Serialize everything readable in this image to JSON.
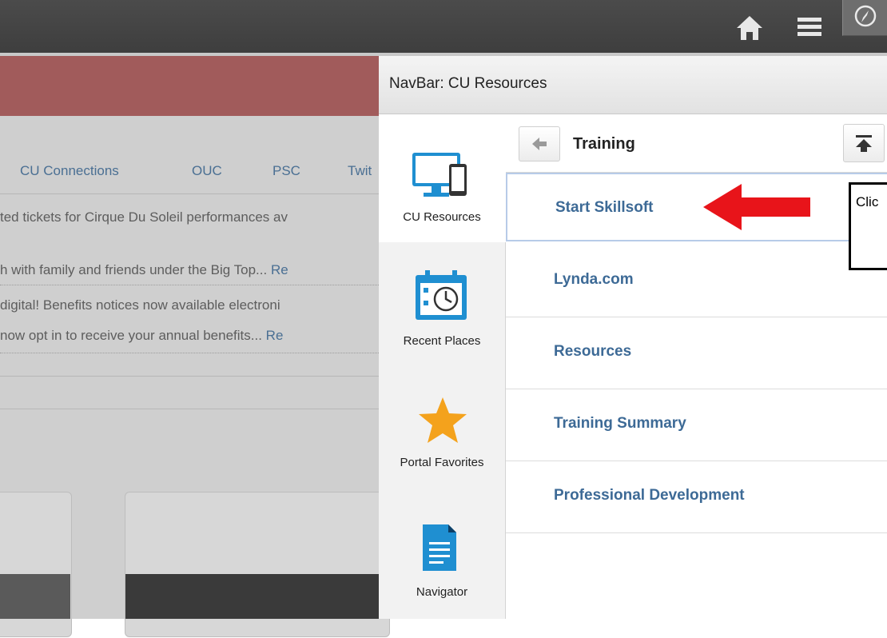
{
  "topbar": {
    "home_icon": "home-icon",
    "menu_icon": "hamburger-menu-icon",
    "navbar_icon": "compass-icon"
  },
  "background": {
    "tabs": [
      "CU Connections",
      "OUC",
      "PSC",
      "Twit"
    ],
    "news": [
      {
        "line1": "ted tickets for Cirque Du Soleil performances av",
        "line2": "h with family and friends under the Big Top...",
        "more": "Re"
      },
      {
        "line1": "digital! Benefits notices now available electroni",
        "line2": "now opt in to receive your annual benefits...",
        "more": "Re"
      }
    ]
  },
  "panel": {
    "title": "NavBar: CU Resources",
    "sidebar": [
      {
        "label": "CU Resources",
        "icon": "devices-icon",
        "active": true
      },
      {
        "label": "Recent Places",
        "icon": "calendar-clock-icon",
        "active": false
      },
      {
        "label": "Portal Favorites",
        "icon": "star-icon",
        "active": false
      },
      {
        "label": "Navigator",
        "icon": "document-icon",
        "active": false
      }
    ],
    "content": {
      "title": "Training",
      "items": [
        "Start Skillsoft",
        "Lynda.com",
        "Resources",
        "Training Summary",
        "Professional Development"
      ]
    }
  },
  "annotation": {
    "callout_text": "Clic"
  },
  "colors": {
    "link": "#3d6a96",
    "arrow": "#e8141a",
    "topbar": "#444444"
  }
}
